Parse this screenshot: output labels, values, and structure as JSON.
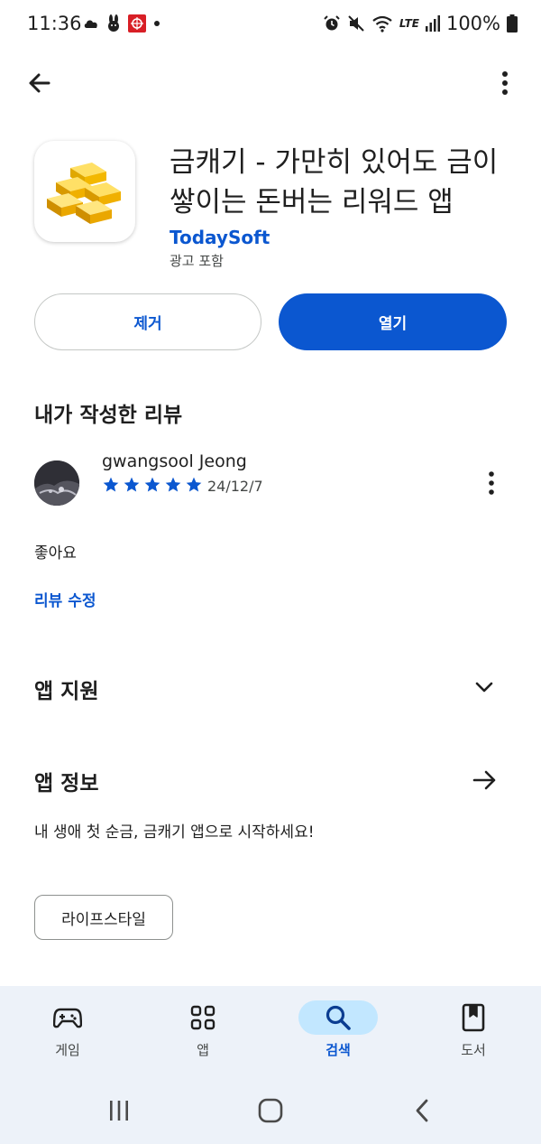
{
  "status_bar": {
    "time": "11:36",
    "battery": "100%",
    "network": "LTE"
  },
  "app": {
    "title": "금캐기 - 가만히 있어도 금이 쌓이는 돈버는 리워드 앱",
    "developer": "TodaySoft",
    "ads": "광고 포함",
    "icon": "gold-bars-icon"
  },
  "buttons": {
    "remove": "제거",
    "open": "열기"
  },
  "my_review": {
    "section_title": "내가 작성한 리뷰",
    "reviewer_name": "gwangsool Jeong",
    "rating": 5,
    "date": "24/12/7",
    "text": "좋아요",
    "edit_label": "리뷰 수정"
  },
  "app_support": {
    "title": "앱 지원"
  },
  "app_info": {
    "title": "앱 정보",
    "description": "내 생애 첫 순금, 금캐기 앱으로 시작하세요!",
    "category_chip": "라이프스타일"
  },
  "bottom_nav": {
    "items": [
      {
        "label": "게임",
        "icon": "gamepad-icon",
        "active": false
      },
      {
        "label": "앱",
        "icon": "apps-grid-icon",
        "active": false
      },
      {
        "label": "검색",
        "icon": "search-icon",
        "active": true
      },
      {
        "label": "도서",
        "icon": "book-icon",
        "active": false
      }
    ]
  },
  "colors": {
    "accent": "#0b57d0",
    "active_pill": "#c2e7ff",
    "nav_bg": "#edf2f9"
  }
}
